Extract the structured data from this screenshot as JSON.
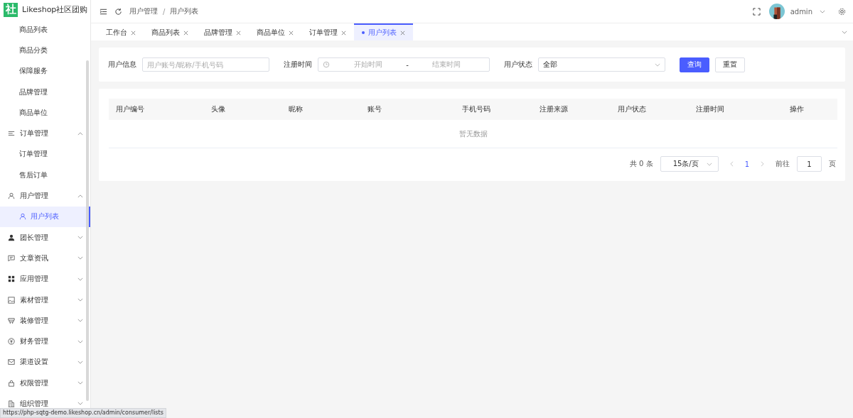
{
  "app": {
    "logo": "社",
    "name": "Likeshop社区团购"
  },
  "sidebar": {
    "items": [
      {
        "label": "商品列表",
        "kind": "item",
        "selected": false
      },
      {
        "label": "商品分类",
        "kind": "item",
        "selected": false
      },
      {
        "label": "保障服务",
        "kind": "item",
        "selected": false
      },
      {
        "label": "品牌管理",
        "kind": "item",
        "selected": false
      },
      {
        "label": "商品单位",
        "kind": "item",
        "selected": false
      },
      {
        "label": "订单管理",
        "kind": "group",
        "expanded": true,
        "children": [
          {
            "label": "订单管理",
            "kind": "item",
            "selected": false
          },
          {
            "label": "售后订单",
            "kind": "item",
            "selected": false
          }
        ]
      },
      {
        "label": "用户管理",
        "kind": "group",
        "expanded": true,
        "children": [
          {
            "label": "用户列表",
            "kind": "icon-item",
            "selected": true
          }
        ]
      },
      {
        "label": "团长管理",
        "kind": "group",
        "expanded": false
      },
      {
        "label": "文章资讯",
        "kind": "group",
        "expanded": false
      },
      {
        "label": "应用管理",
        "kind": "group",
        "expanded": false
      },
      {
        "label": "素材管理",
        "kind": "group",
        "expanded": false
      },
      {
        "label": "装修管理",
        "kind": "group",
        "expanded": false
      },
      {
        "label": "财务管理",
        "kind": "group",
        "expanded": false
      },
      {
        "label": "渠道设置",
        "kind": "group",
        "expanded": false
      },
      {
        "label": "权限管理",
        "kind": "group",
        "expanded": false
      },
      {
        "label": "组织管理",
        "kind": "group",
        "expanded": false
      }
    ]
  },
  "header": {
    "breadcrumb": [
      "用户管理",
      "用户列表"
    ],
    "breadcrumb_separator": "/",
    "user": "admin"
  },
  "tabs": [
    {
      "label": "工作台",
      "selected": false
    },
    {
      "label": "商品列表",
      "selected": false
    },
    {
      "label": "品牌管理",
      "selected": false
    },
    {
      "label": "商品单位",
      "selected": false
    },
    {
      "label": "订单管理",
      "selected": false
    },
    {
      "label": "用户列表",
      "selected": true
    }
  ],
  "filters": {
    "user_info": {
      "label": "用户信息",
      "placeholder": "用户账号/昵称/手机号码"
    },
    "register_time": {
      "label": "注册时间",
      "start_placeholder": "开始时间",
      "separator": "-",
      "end_placeholder": "结束时间"
    },
    "user_status": {
      "label": "用户状态",
      "value": "全部"
    },
    "buttons": [
      {
        "label": "查询",
        "kind": "primary"
      },
      {
        "label": "重置",
        "kind": "default"
      }
    ]
  },
  "table": {
    "columns": [
      "用户编号",
      "头像",
      "昵称",
      "账号",
      "手机号码",
      "注册来源",
      "用户状态",
      "注册时间",
      "操作"
    ],
    "empty_text": "暂无数据"
  },
  "pagination": {
    "total": "共 0 条",
    "page_size": "15条/页",
    "pages": [
      {
        "label": "1",
        "selected": true
      }
    ],
    "goto_label": "前往",
    "goto_value": "1",
    "goto_suffix": "页"
  },
  "status_url": "https://php-sqtg-demo.likeshop.cn/admin/consumer/lists"
}
